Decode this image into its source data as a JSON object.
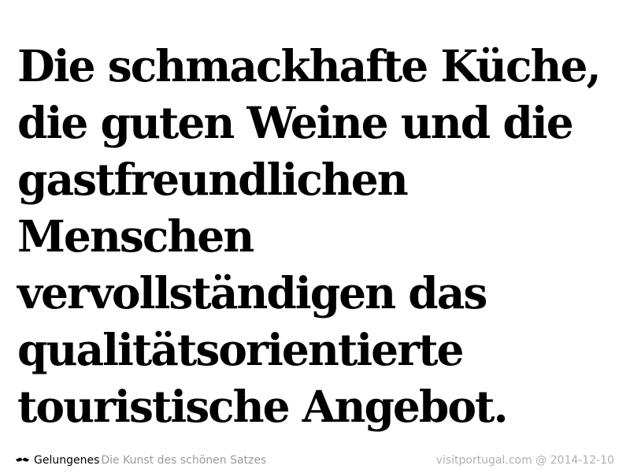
{
  "quote": {
    "lines": [
      "Die schmackhafte Küche,",
      "die guten Weine und die",
      "gastfreundlichen",
      "Menschen",
      "vervollständigen das",
      "qualitätsorientierte",
      "touristische Angebot."
    ]
  },
  "footer": {
    "icon": "mustache-icon",
    "brand": "Gelungenes",
    "tagline": "Die Kunst des schönen Satzes",
    "source": "visitportugal.com @ 2014-12-10"
  },
  "colors": {
    "background": "#ffffff",
    "text": "#000000",
    "muted": "#9a9a9a",
    "source": "#b0b0b0"
  }
}
